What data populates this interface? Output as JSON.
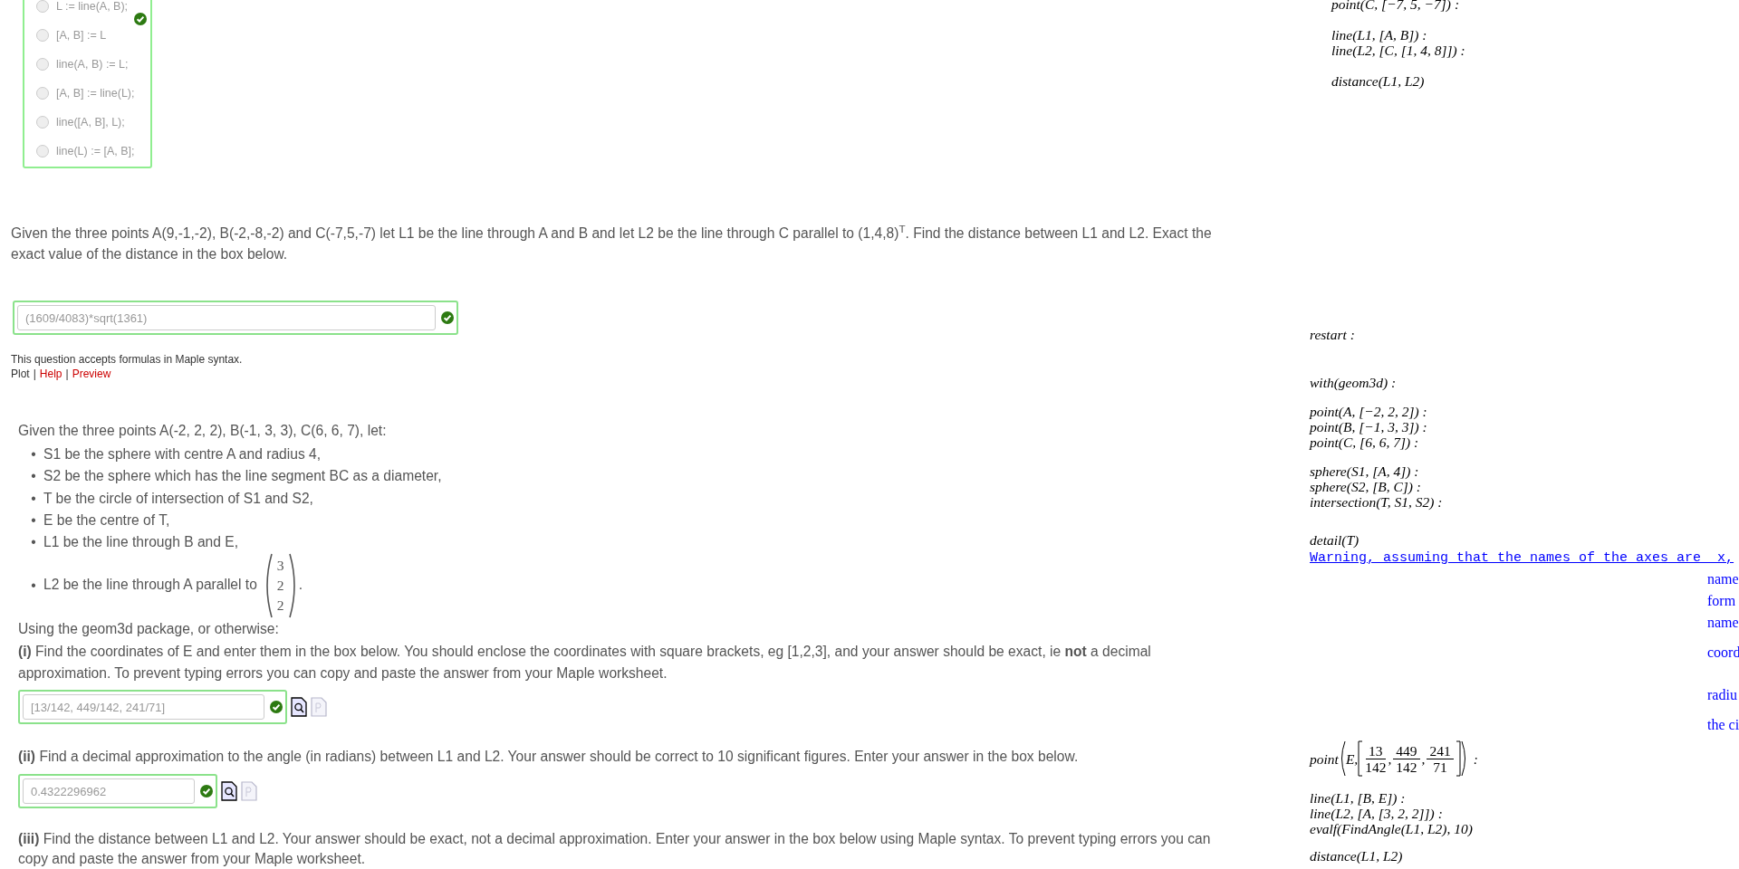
{
  "question_1": {
    "options": [
      {
        "label": "L := line(A, B);",
        "selected": false
      },
      {
        "label": "[A, B] := L",
        "selected": false
      },
      {
        "label": "line(A, B) := L;",
        "selected": false
      },
      {
        "label": "[A, B] := line(L);",
        "selected": false
      },
      {
        "label": "line([A, B], L);",
        "selected": false
      },
      {
        "label": "line(L) := [A, B];",
        "selected": false
      }
    ],
    "marked_correct": true
  },
  "question_2": {
    "text": "Given the three points A(9,-1,-2), B(-2,-8,-2) and C(-7,5,-7) let L1 be the line through A and B and let L2 be the line through C parallel to (1,4,8)$^{T}$.  Find the distance between L1 and L2.  Exact the exact value of the distance in the box below.",
    "answer": {
      "value": "(1609/4083)*sqrt(1361)",
      "marked_correct": true
    },
    "syntax_note": "This question accepts formulas in Maple syntax.",
    "links": [
      {
        "label": "Plot",
        "kind": "plain"
      },
      {
        "label": "|",
        "kind": "separator"
      },
      {
        "label": "Help",
        "kind": "link"
      },
      {
        "label": "|",
        "kind": "separator"
      },
      {
        "label": "Preview",
        "kind": "link"
      }
    ]
  },
  "question_3": {
    "intro": "Given the three points A(-2, 2, 2), B(-1, 3, 3), C(6, 6, 7), let:",
    "items": [
      {
        "bullet": "•",
        "text": "S1 be the sphere with centre A and radius 4,"
      },
      {
        "bullet": "•",
        "text": "S2 be the sphere which has the line segment BC as a diameter,"
      },
      {
        "bullet": "•",
        "text": "T be the circle of intersection of S1 and S2,"
      },
      {
        "bullet": "•",
        "text": "E be the centre of T,"
      },
      {
        "bullet": "•",
        "text": "L1 be the line through B and E,"
      },
      {
        "bullet": "•",
        "text": "L2 be the line through A parallel to",
        "vector": [
          "3",
          "2",
          "2"
        ],
        "after": "."
      }
    ],
    "method": "Using the geom3d package, or otherwise:",
    "parts": [
      {
        "text": "**(i)** Find the coordinates of E and enter them in the box below. You should enclose the coordinates with square brackets, eg [1,2,3], and your answer should be exact, ie **not** a decimal approximation. To prevent typing errors you can copy and paste the answer from your Maple worksheet.",
        "answer": {
          "value": "[13/142, 449/142, 241/71]",
          "marked_correct": true
        }
      },
      {
        "text": "**(ii)** Find a decimal approximation to the angle (in radians) between L1 and L2.  Your answer should be correct to 10 significant figures.  Enter your answer in the box below.",
        "answer": {
          "value": "0.4322296962",
          "marked_correct": true
        }
      },
      {
        "text": "**(iii)** Find the distance between L1 and L2. Your answer should be exact, not a decimal approximation.  Enter your answer in the box below using Maple syntax. To prevent typing errors you can copy and paste the answer from your Maple worksheet."
      }
    ]
  },
  "maple_top": {
    "groups": [
      [
        "point(C, [−7, 5, −7]) :"
      ],
      [
        "line(L1, [A, B]) :",
        "line(L2, [C, [1, 4, 8]]) :"
      ],
      [
        "distance(L1, L2)"
      ]
    ]
  },
  "maple_main": {
    "groups": [
      {
        "kind": "lines",
        "lines": [
          "restart :"
        ]
      },
      {
        "kind": "lines",
        "lines": [
          "with(geom3d) :"
        ]
      },
      {
        "kind": "lines",
        "lines": [
          "point(A, [−2, 2, 2]) :",
          "point(B, [−1, 3, 3]) :",
          "point(C, [6, 6, 7]) :"
        ]
      },
      {
        "kind": "lines",
        "lines": [
          "sphere(S1, [A, 4]) :",
          "sphere(S2, [B, C]) :",
          "intersection(T, S1, S2) :"
        ]
      },
      {
        "kind": "lines",
        "lines": [
          "detail(T)"
        ]
      },
      {
        "kind": "warning",
        "text": "Warning, assuming that the names of the axes are _x,"
      },
      {
        "kind": "output",
        "words": [
          "name",
          "form",
          "name",
          "coord",
          "radiu",
          "the ci"
        ]
      },
      {
        "kind": "fraction_point",
        "head": "point",
        "arg": "E,",
        "fractions": [
          {
            "num": "13",
            "den": "142"
          },
          {
            "num": "449",
            "den": "142"
          },
          {
            "num": "241",
            "den": "71"
          }
        ],
        "separators": [
          ",",
          ","
        ],
        "tail": ":"
      },
      {
        "kind": "lines",
        "lines": [
          "line(L1, [B, E]) :",
          "line(L2, [A, [3, 2, 2]]) :",
          "evalf(FindAngle(L1, L2), 10)"
        ]
      },
      {
        "kind": "lines",
        "lines": [
          "distance(L1, L2)"
        ]
      }
    ]
  }
}
